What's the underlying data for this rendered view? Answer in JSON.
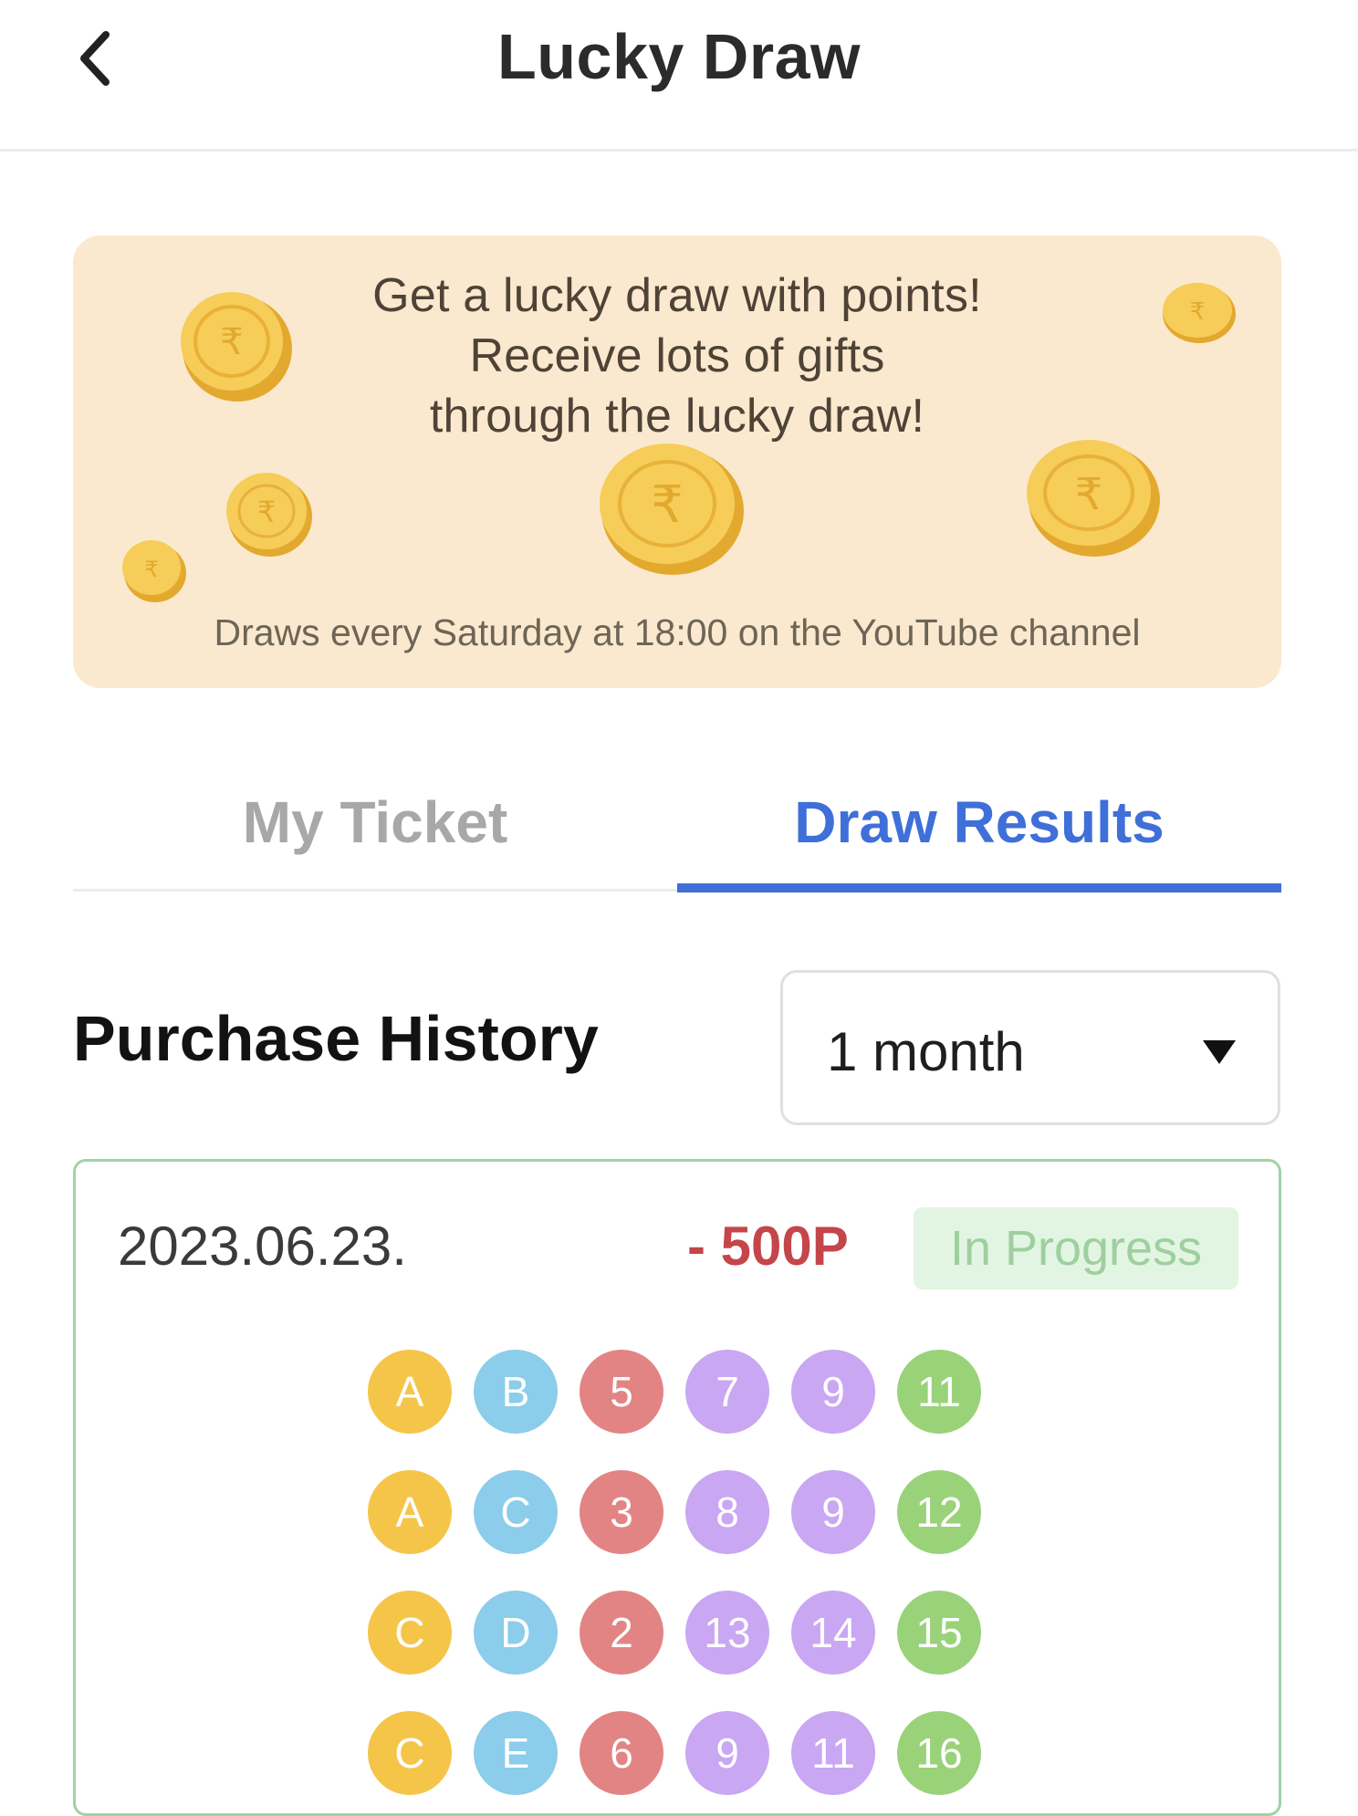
{
  "header": {
    "back_icon": "chevron-left-icon",
    "title": "Lucky Draw"
  },
  "banner": {
    "line1": "Get a lucky draw with points!",
    "line2": "Receive lots of gifts",
    "line3": "through the lucky draw!",
    "subtitle": "Draws every Saturday at 18:00 on the YouTube channel",
    "background_color": "#fbe9cf",
    "decoration_icon": "coin-icon"
  },
  "tabs": [
    {
      "label": "My Ticket",
      "active": false
    },
    {
      "label": "Draw Results",
      "active": true
    }
  ],
  "history": {
    "title": "Purchase History",
    "period": {
      "value": "1 month",
      "icon": "triangle-down-icon"
    }
  },
  "entries": [
    {
      "date": "2023.06.23.",
      "points": "- 500P",
      "status": "In Progress",
      "rows": [
        [
          "A",
          "B",
          "5",
          "7",
          "9",
          "11"
        ],
        [
          "A",
          "C",
          "3",
          "8",
          "9",
          "12"
        ],
        [
          "C",
          "D",
          "2",
          "13",
          "14",
          "15"
        ],
        [
          "C",
          "E",
          "6",
          "9",
          "11",
          "16"
        ]
      ]
    }
  ],
  "colors": {
    "accent": "#3f6fd8",
    "points": "#c4454a",
    "status_bg": "#e2f5e2",
    "status_text": "#9fcf9f",
    "card_border": "#9fd3a6",
    "ball_colors": [
      "#f5c54a",
      "#8bcdea",
      "#e38484",
      "#c9a7f2",
      "#c9a7f2",
      "#9ad27a"
    ]
  }
}
